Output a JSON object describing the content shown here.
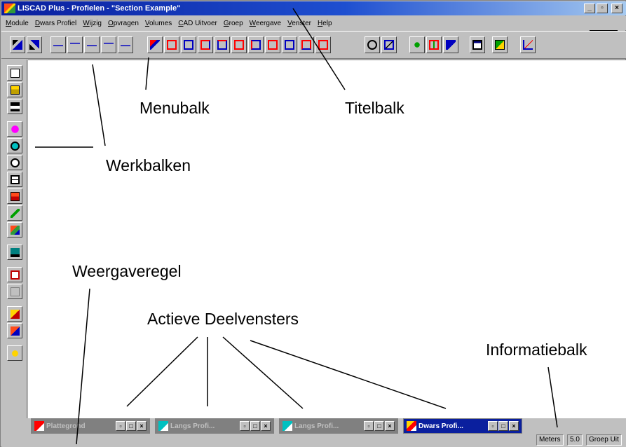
{
  "window": {
    "title": "LISCAD Plus - Profielen - \"Section Example\"",
    "controls": {
      "minimize": "_",
      "restore": "▫",
      "close": "×"
    }
  },
  "menubar": {
    "items": [
      "Module",
      "Dwars Profiel",
      "Wijzig",
      "Opvragen",
      "Volumes",
      "CAD Uitvoer",
      "Groep",
      "Weergave",
      "Venster",
      "Help"
    ]
  },
  "toolbar": {
    "icons": [
      "select-icon",
      "select-all-icon",
      "profile-1-icon",
      "profile-2-icon",
      "profile-3-icon",
      "profile-4-icon",
      "profile-5-icon",
      "edit-icon",
      "template-1-icon",
      "template-2-icon",
      "template-3-icon",
      "template-4-icon",
      "template-5-icon",
      "template-6-icon",
      "template-7-icon",
      "template-8-icon",
      "template-9-icon",
      "template-10-icon",
      "zoom-area-icon",
      "zoom-fit-icon",
      "star-icon",
      "insert-icon",
      "flag-icon",
      "window-icon",
      "export-icon",
      "graph-icon"
    ]
  },
  "lefttoolbar": {
    "icons": [
      "new-file-icon",
      "open-file-icon",
      "save-icon",
      "pan-icon",
      "zoom-in-icon",
      "zoom-out-icon",
      "frame-icon",
      "layers-icon",
      "pencil-icon",
      "map-icon",
      "display-icon",
      "info-icon",
      "disabled-icon",
      "report-icon",
      "edit-report-icon",
      "help-icon"
    ]
  },
  "mini_windows": [
    {
      "title": "Plattegrond",
      "active": false
    },
    {
      "title": "Langs Profi...",
      "active": false
    },
    {
      "title": "Langs Profi...",
      "active": false
    },
    {
      "title": "Dwars Profi...",
      "active": true
    }
  ],
  "statusbar": {
    "units": "Meters",
    "scale": "5.0",
    "group": "Groep Uit"
  },
  "annotations": {
    "menubalk": "Menubalk",
    "titelbalk": "Titelbalk",
    "werkbalken": "Werkbalken",
    "weergaveregel": "Weergaveregel",
    "actieve_deelvensters": "Actieve Deelvensters",
    "informatiebalk": "Informatiebalk"
  },
  "colors": {
    "title_active": "#0a1f9e",
    "face": "#c0c0c0",
    "workspace": "#ffffff",
    "mini_inactive": "#808080"
  }
}
